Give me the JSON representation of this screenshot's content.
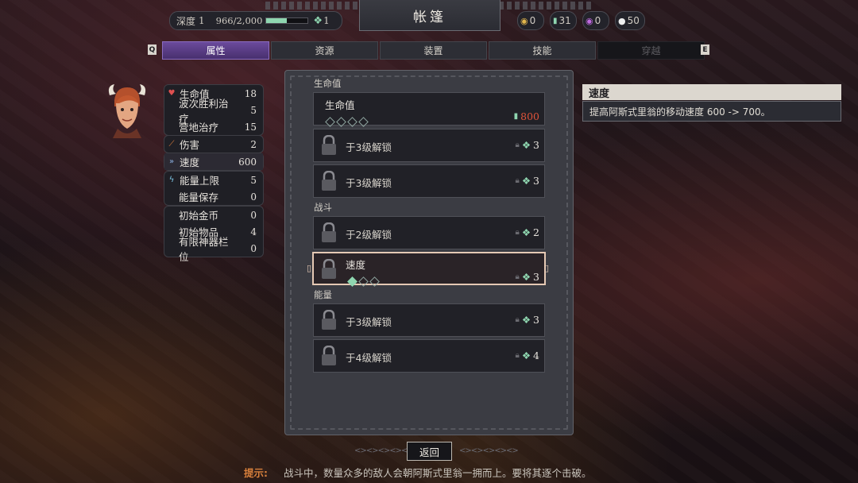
{
  "header": {
    "title": "帐篷",
    "depth_label": "深度",
    "depth_value": "1",
    "xp_text": "966/2,000",
    "xp_progress": 0.483,
    "gem_level": "1"
  },
  "currencies": [
    {
      "icon": "coin-icon",
      "value": "0"
    },
    {
      "icon": "gem-currency-icon",
      "value": "31"
    },
    {
      "icon": "purple-orb-icon",
      "value": "0"
    },
    {
      "icon": "white-orb-icon",
      "value": "50"
    }
  ],
  "tabs": {
    "prev_key": "Q",
    "next_key": "E",
    "items": [
      {
        "label": "属性"
      },
      {
        "label": "资源"
      },
      {
        "label": "装置"
      },
      {
        "label": "技能"
      },
      {
        "label": "穿越"
      }
    ]
  },
  "stats": {
    "health": [
      {
        "label": "生命值",
        "value": "18",
        "icon": "heart-icon"
      },
      {
        "label": "波次胜利治疗",
        "value": "5"
      },
      {
        "label": "营地治疗",
        "value": "15"
      }
    ],
    "damage": [
      {
        "label": "伤害",
        "value": "2",
        "icon": "sword-icon"
      }
    ],
    "speed": [
      {
        "label": "速度",
        "value": "600",
        "icon": "speed-chevron-icon"
      }
    ],
    "energy": [
      {
        "label": "能量上限",
        "value": "5",
        "icon": "lightning-icon"
      },
      {
        "label": "能量保存",
        "value": "0"
      }
    ],
    "misc": [
      {
        "label": "初始金币",
        "value": "0"
      },
      {
        "label": "初始物品",
        "value": "4"
      },
      {
        "label": "有限神器栏位",
        "value": "0"
      }
    ]
  },
  "upgrades": {
    "section_health": "生命值",
    "section_combat": "战斗",
    "section_energy": "能量",
    "items": [
      {
        "name": "生命值",
        "cost": "800",
        "ranks": 4,
        "filled": 0
      },
      {
        "name": "于3级解锁",
        "cost": "3"
      },
      {
        "name": "于3级解锁",
        "cost": "3"
      },
      {
        "name": "于2级解锁",
        "cost": "2"
      },
      {
        "name": "速度",
        "cost": "3",
        "ranks": 3,
        "filled": 1
      },
      {
        "name": "于3级解锁",
        "cost": "3"
      },
      {
        "name": "于4级解锁",
        "cost": "4"
      }
    ]
  },
  "tooltip": {
    "title": "速度",
    "text": "提高阿斯式里翁的移动速度 600 -> 700。"
  },
  "footer": {
    "back_label": "返回",
    "hint_key": "提示:",
    "hint_text": "战斗中，数量众多的敌人会朝阿斯式里翁一拥而上。要将其逐个击破。"
  },
  "colors": {
    "accent_purple": "#6b4a9c",
    "gem_green": "#8fd6b0",
    "cost_red": "#e0533a",
    "hint_orange": "#d8803c"
  }
}
